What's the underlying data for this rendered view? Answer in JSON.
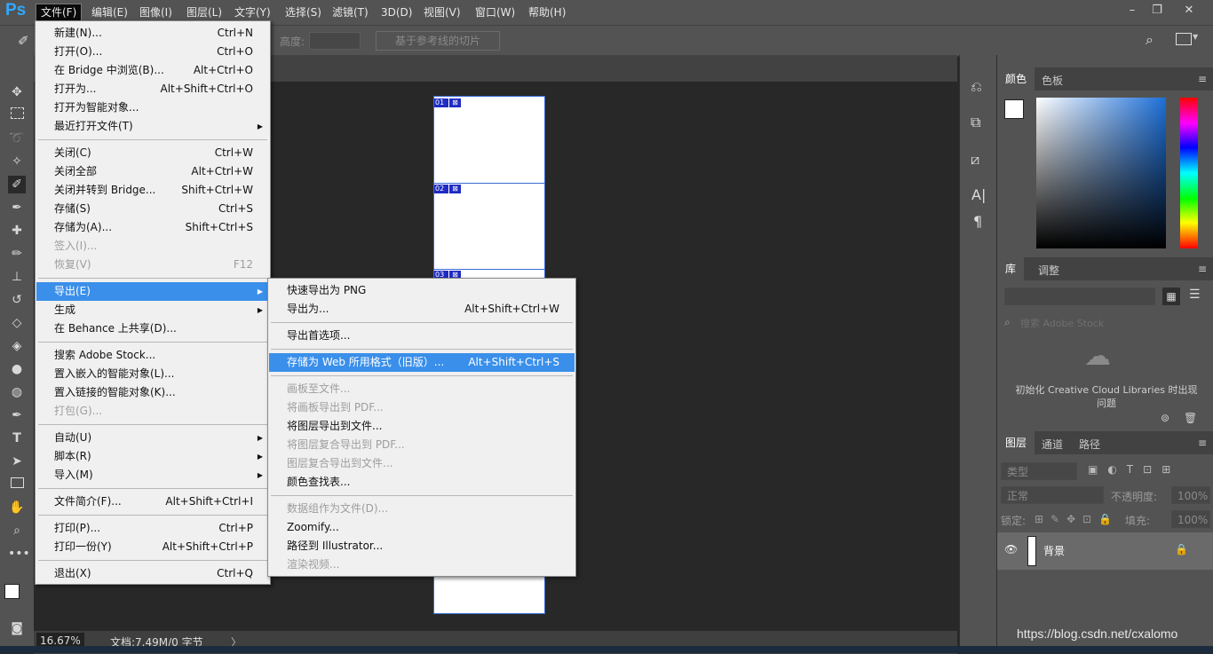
{
  "app": {
    "logo": "Ps"
  },
  "menubar": [
    {
      "label": "文件(F)",
      "active": true
    },
    {
      "label": "编辑(E)"
    },
    {
      "label": "图像(I)"
    },
    {
      "label": "图层(L)"
    },
    {
      "label": "文字(Y)"
    },
    {
      "label": "选择(S)"
    },
    {
      "label": "滤镜(T)"
    },
    {
      "label": "3D(D)"
    },
    {
      "label": "视图(V)"
    },
    {
      "label": "窗口(W)"
    },
    {
      "label": "帮助(H)"
    }
  ],
  "window_controls": {
    "minimize": "–",
    "restore": "❐",
    "close": "✕"
  },
  "options_bar": {
    "height_label": "高度:",
    "slice_button": "基于参考线的切片"
  },
  "file_menu": [
    {
      "label": "新建(N)...",
      "shortcut": "Ctrl+N"
    },
    {
      "label": "打开(O)...",
      "shortcut": "Ctrl+O"
    },
    {
      "label": "在 Bridge 中浏览(B)...",
      "shortcut": "Alt+Ctrl+O"
    },
    {
      "label": "打开为...",
      "shortcut": "Alt+Shift+Ctrl+O"
    },
    {
      "label": "打开为智能对象..."
    },
    {
      "label": "最近打开文件(T)",
      "submenu": true
    },
    {
      "sep": true
    },
    {
      "label": "关闭(C)",
      "shortcut": "Ctrl+W"
    },
    {
      "label": "关闭全部",
      "shortcut": "Alt+Ctrl+W"
    },
    {
      "label": "关闭并转到 Bridge...",
      "shortcut": "Shift+Ctrl+W"
    },
    {
      "label": "存储(S)",
      "shortcut": "Ctrl+S"
    },
    {
      "label": "存储为(A)...",
      "shortcut": "Shift+Ctrl+S"
    },
    {
      "label": "签入(I)...",
      "disabled": true
    },
    {
      "label": "恢复(V)",
      "shortcut": "F12",
      "disabled": true
    },
    {
      "sep": true
    },
    {
      "label": "导出(E)",
      "submenu": true,
      "highlight": true
    },
    {
      "label": "生成",
      "submenu": true
    },
    {
      "label": "在 Behance 上共享(D)..."
    },
    {
      "sep": true
    },
    {
      "label": "搜索 Adobe Stock..."
    },
    {
      "label": "置入嵌入的智能对象(L)..."
    },
    {
      "label": "置入链接的智能对象(K)..."
    },
    {
      "label": "打包(G)...",
      "disabled": true
    },
    {
      "sep": true
    },
    {
      "label": "自动(U)",
      "submenu": true
    },
    {
      "label": "脚本(R)",
      "submenu": true
    },
    {
      "label": "导入(M)",
      "submenu": true
    },
    {
      "sep": true
    },
    {
      "label": "文件简介(F)...",
      "shortcut": "Alt+Shift+Ctrl+I"
    },
    {
      "sep": true
    },
    {
      "label": "打印(P)...",
      "shortcut": "Ctrl+P"
    },
    {
      "label": "打印一份(Y)",
      "shortcut": "Alt+Shift+Ctrl+P"
    },
    {
      "sep": true
    },
    {
      "label": "退出(X)",
      "shortcut": "Ctrl+Q"
    }
  ],
  "export_submenu": [
    {
      "label": "快速导出为 PNG"
    },
    {
      "label": "导出为...",
      "shortcut": "Alt+Shift+Ctrl+W"
    },
    {
      "sep": true
    },
    {
      "label": "导出首选项..."
    },
    {
      "sep": true
    },
    {
      "label": "存储为 Web 所用格式（旧版）...",
      "shortcut": "Alt+Shift+Ctrl+S",
      "highlight": true
    },
    {
      "sep": true
    },
    {
      "label": "画板至文件...",
      "disabled": true
    },
    {
      "label": "将画板导出到 PDF...",
      "disabled": true
    },
    {
      "label": "将图层导出到文件..."
    },
    {
      "label": "将图层复合导出到 PDF...",
      "disabled": true
    },
    {
      "label": "图层复合导出到文件...",
      "disabled": true
    },
    {
      "label": "颜色查找表..."
    },
    {
      "sep": true
    },
    {
      "label": "数据组作为文件(D)...",
      "disabled": true
    },
    {
      "label": "Zoomify..."
    },
    {
      "label": "路径到 Illustrator..."
    },
    {
      "label": "渲染视频...",
      "disabled": true
    }
  ],
  "canvas": {
    "slices": [
      {
        "num": "01",
        "icon": "⊠"
      },
      {
        "num": "02",
        "icon": "⊠"
      },
      {
        "num": "03",
        "icon": "⊠"
      }
    ]
  },
  "status": {
    "zoom": "16.67%",
    "doc": "文档:7.49M/0 字节",
    "arrow": "〉"
  },
  "panels": {
    "color": {
      "tabs": [
        "颜色",
        "色板"
      ]
    },
    "libraries": {
      "tabs": [
        "库",
        "调整"
      ],
      "search_placeholder": "搜索 Adobe Stock",
      "message": "初始化 Creative Cloud Libraries 时出现问题"
    },
    "layers": {
      "tabs": [
        "图层",
        "通道",
        "路径"
      ],
      "filter_label": "类型",
      "blend_mode": "正常",
      "opacity_label": "不透明度:",
      "opacity_value": "100%",
      "lock_label": "锁定:",
      "fill_label": "填充:",
      "fill_value": "100%",
      "layer_name": "背景"
    }
  },
  "colors": {
    "accent": "#3a8fea",
    "slice_blue": "#1f2bc2"
  },
  "watermark": "https://blog.csdn.net/cxalomo"
}
